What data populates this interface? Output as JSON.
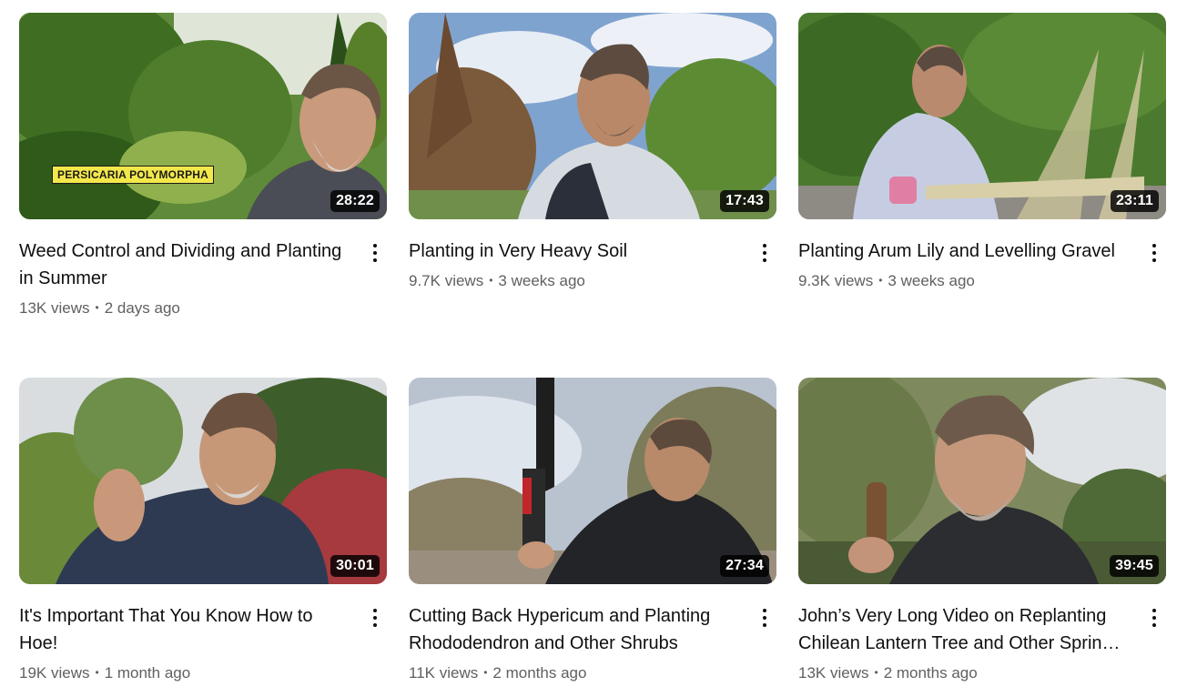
{
  "videos": [
    {
      "title": "Weed Control and Dividing and Planting in Summer",
      "duration": "28:22",
      "views": "13K views",
      "age": "2 days ago",
      "overlay_caption": "PERSICARIA POLYMORPHA",
      "menu_icon": "more-vert-icon"
    },
    {
      "title": "Planting in Very Heavy Soil",
      "duration": "17:43",
      "views": "9.7K views",
      "age": "3 weeks ago",
      "menu_icon": "more-vert-icon"
    },
    {
      "title": "Planting Arum Lily and Levelling Gravel",
      "duration": "23:11",
      "views": "9.3K views",
      "age": "3 weeks ago",
      "menu_icon": "more-vert-icon"
    },
    {
      "title": "It's Important That You Know How to Hoe!",
      "duration": "30:01",
      "views": "19K views",
      "age": "1 month ago",
      "menu_icon": "more-vert-icon"
    },
    {
      "title": "Cutting Back Hypericum and Planting Rhododendron and Other Shrubs",
      "duration": "27:34",
      "views": "11K views",
      "age": "2 months ago",
      "menu_icon": "more-vert-icon"
    },
    {
      "title": "John’s Very Long Video on Replanting Chilean Lantern Tree and Other Spring Shrubs",
      "duration": "39:45",
      "views": "13K views",
      "age": "2 months ago",
      "menu_icon": "more-vert-icon"
    }
  ],
  "colors": {
    "title_text": "#0f0f0f",
    "meta_text": "#606060",
    "duration_badge_bg": "#000000",
    "caption_bg": "#f3e84a"
  }
}
